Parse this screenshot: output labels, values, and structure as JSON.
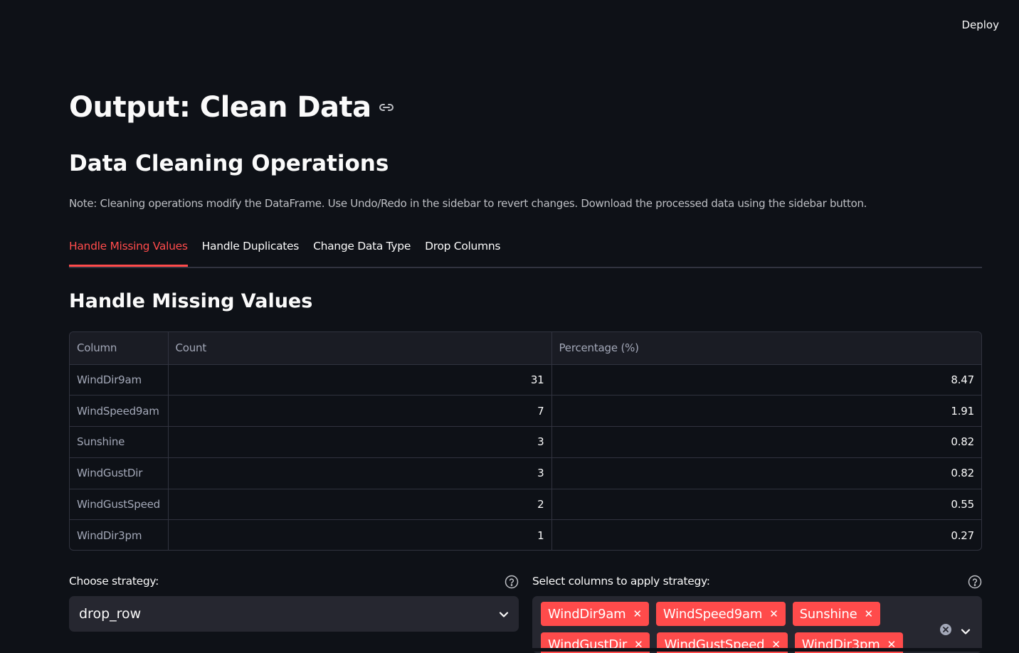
{
  "header": {
    "deploy_label": "Deploy"
  },
  "page": {
    "title": "Output: Clean Data",
    "section_title": "Data Cleaning Operations",
    "note": "Note: Cleaning operations modify the DataFrame. Use Undo/Redo in the sidebar to revert changes. Download the processed data using the sidebar button."
  },
  "tabs": [
    {
      "label": "Handle Missing Values",
      "active": true
    },
    {
      "label": "Handle Duplicates",
      "active": false
    },
    {
      "label": "Change Data Type",
      "active": false
    },
    {
      "label": "Drop Columns",
      "active": false
    }
  ],
  "missing": {
    "title": "Handle Missing Values",
    "columns": [
      "Column",
      "Count",
      "Percentage (%)"
    ],
    "rows": [
      {
        "column": "WindDir9am",
        "count": "31",
        "pct": "8.47"
      },
      {
        "column": "WindSpeed9am",
        "count": "7",
        "pct": "1.91"
      },
      {
        "column": "Sunshine",
        "count": "3",
        "pct": "0.82"
      },
      {
        "column": "WindGustDir",
        "count": "3",
        "pct": "0.82"
      },
      {
        "column": "WindGustSpeed",
        "count": "2",
        "pct": "0.55"
      },
      {
        "column": "WindDir3pm",
        "count": "1",
        "pct": "0.27"
      }
    ]
  },
  "strategy": {
    "label": "Choose strategy:",
    "value": "drop_row"
  },
  "columns_select": {
    "label": "Select columns to apply strategy:",
    "selected": [
      "WindDir9am",
      "WindSpeed9am",
      "Sunshine",
      "WindGustDir",
      "WindGustSpeed",
      "WindDir3pm"
    ]
  },
  "colors": {
    "accent": "#ff4b4b",
    "background": "#0e1117",
    "widget_bg": "#262730"
  }
}
